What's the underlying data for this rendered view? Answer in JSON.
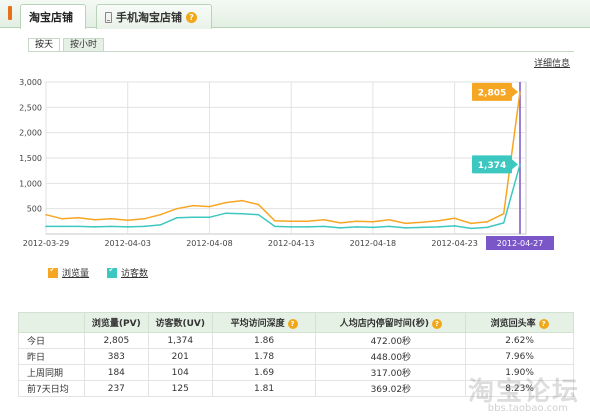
{
  "tabs": {
    "main_active": "淘宝店铺",
    "main_inactive": "手机淘宝店铺"
  },
  "subtabs": {
    "day": "按天",
    "hour": "按小时"
  },
  "detail_link": "详细信息",
  "colors": {
    "pv": "#f5a623",
    "uv": "#3cc8c0",
    "accent": "#e8701a",
    "highlight": "#7b56c8"
  },
  "chart_data": {
    "type": "line",
    "x": [
      "2012-03-29",
      "2012-03-30",
      "2012-03-31",
      "2012-04-01",
      "2012-04-02",
      "2012-04-03",
      "2012-04-04",
      "2012-04-05",
      "2012-04-06",
      "2012-04-07",
      "2012-04-08",
      "2012-04-09",
      "2012-04-10",
      "2012-04-11",
      "2012-04-12",
      "2012-04-13",
      "2012-04-14",
      "2012-04-15",
      "2012-04-16",
      "2012-04-17",
      "2012-04-18",
      "2012-04-19",
      "2012-04-20",
      "2012-04-21",
      "2012-04-22",
      "2012-04-23",
      "2012-04-24",
      "2012-04-25",
      "2012-04-26",
      "2012-04-27"
    ],
    "x_ticks": [
      "2012-03-29",
      "2012-04-03",
      "2012-04-08",
      "2012-04-13",
      "2012-04-18",
      "2012-04-23",
      "2012-04-27"
    ],
    "highlight_x": "2012-04-27",
    "ylim": [
      0,
      3000
    ],
    "y_ticks": [
      "3,000",
      "2,500",
      "2,000",
      "1,500",
      "1,000",
      "500"
    ],
    "y_tick_values": [
      3000,
      2500,
      2000,
      1500,
      1000,
      500
    ],
    "series": [
      {
        "name": "浏览量",
        "color": "#f5a623",
        "values": [
          380,
          300,
          320,
          280,
          300,
          270,
          300,
          380,
          500,
          560,
          540,
          620,
          660,
          580,
          260,
          250,
          250,
          280,
          220,
          250,
          240,
          280,
          210,
          230,
          260,
          310,
          210,
          240,
          400,
          2805
        ]
      },
      {
        "name": "访客数",
        "color": "#3cc8c0",
        "values": [
          150,
          150,
          150,
          140,
          150,
          140,
          150,
          180,
          320,
          330,
          330,
          410,
          400,
          380,
          150,
          140,
          140,
          150,
          120,
          140,
          130,
          150,
          120,
          130,
          140,
          160,
          110,
          130,
          220,
          1374
        ]
      }
    ],
    "callouts": [
      {
        "series": "浏览量",
        "label": "2,805"
      },
      {
        "series": "访客数",
        "label": "1,374"
      }
    ],
    "grid": true
  },
  "legend": {
    "pv": "浏览量",
    "uv": "访客数"
  },
  "table": {
    "headers": [
      "",
      "浏览量(PV)",
      "访客数(UV)",
      "平均访问深度",
      "人均店内停留时间(秒)",
      "浏览回头率"
    ],
    "rows": [
      [
        "今日",
        "2,805",
        "1,374",
        "1.86",
        "472.00秒",
        "2.62%"
      ],
      [
        "昨日",
        "383",
        "201",
        "1.78",
        "448.00秒",
        "7.96%"
      ],
      [
        "上周同期",
        "184",
        "104",
        "1.69",
        "317.00秒",
        "1.90%"
      ],
      [
        "前7天日均",
        "237",
        "125",
        "1.81",
        "369.02秒",
        "8.23%"
      ]
    ]
  },
  "watermark": "淘宝论坛",
  "watermark_sub": "bbs.taobao.com"
}
